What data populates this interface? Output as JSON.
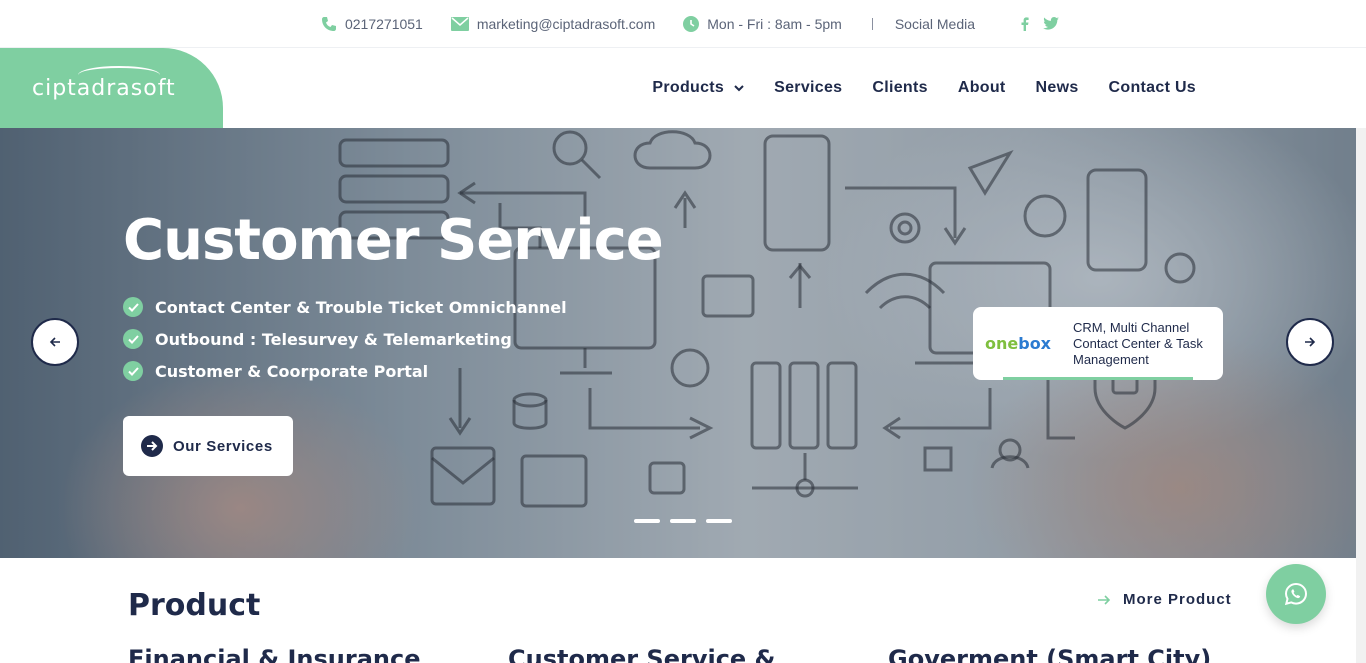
{
  "topbar": {
    "phone": "0217271051",
    "email": "marketing@ciptadrasoft.com",
    "hours": "Mon - Fri : 8am - 5pm",
    "social_label": "Social Media",
    "social_icons": [
      "facebook-icon",
      "twitter-icon"
    ]
  },
  "header": {
    "logo": "ciptadrasoft",
    "nav": [
      {
        "label": "Products",
        "has_dropdown": true
      },
      {
        "label": "Services"
      },
      {
        "label": "Clients"
      },
      {
        "label": "About"
      },
      {
        "label": "News"
      },
      {
        "label": "Contact Us"
      }
    ]
  },
  "hero": {
    "title": "Customer Service",
    "bullets": [
      "Contact Center & Trouble Ticket Omnichannel",
      "Outbound : Telesurvey & Telemarketing",
      "Customer & Coorporate Portal"
    ],
    "button_label": "Our Services",
    "card": {
      "logo_part1": "one",
      "logo_part2": "box",
      "text": "CRM, Multi Channel Contact Center & Task Management"
    },
    "slide_count": 3
  },
  "product": {
    "title": "Product",
    "more_label": "More Product",
    "categories": [
      "Financial & Insurance",
      "Customer Service &",
      "Goverment (Smart City)"
    ]
  },
  "colors": {
    "accent": "#7fcfa1",
    "navy": "#1f2a4a"
  }
}
